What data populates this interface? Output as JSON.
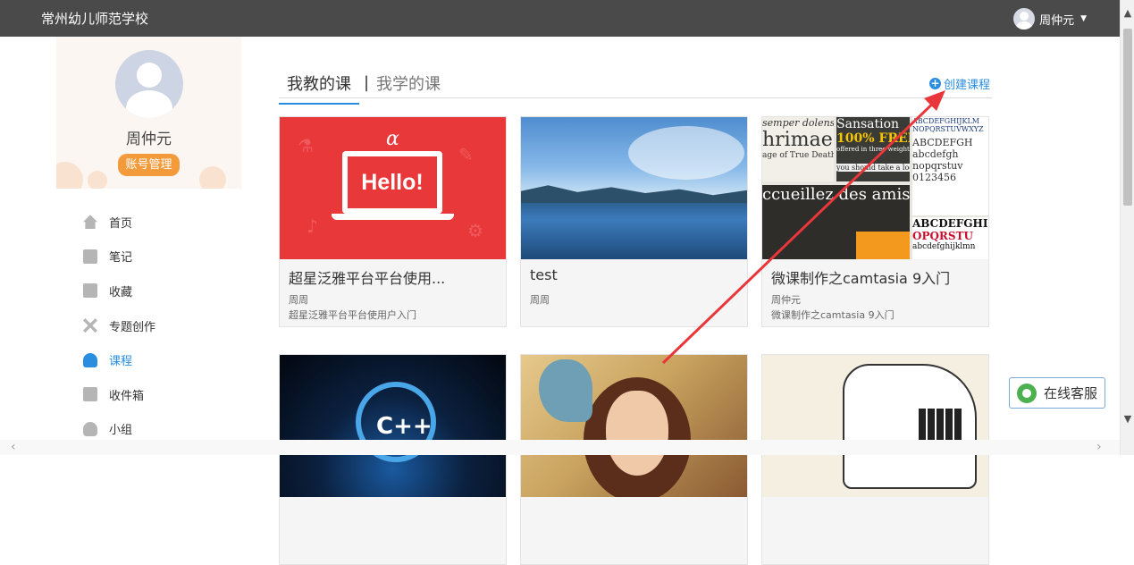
{
  "header": {
    "school_name": "常州幼儿师范学校",
    "user_name": "周仲元",
    "caret_icon": "chevron-down-icon"
  },
  "sidebar": {
    "profile_name": "周仲元",
    "account_button": "账号管理",
    "items": [
      {
        "label": "首页",
        "icon": "home-icon"
      },
      {
        "label": "笔记",
        "icon": "note-icon"
      },
      {
        "label": "收藏",
        "icon": "bookmark-icon"
      },
      {
        "label": "专题创作",
        "icon": "tools-icon"
      },
      {
        "label": "课程",
        "icon": "course-icon",
        "active": true
      },
      {
        "label": "收件箱",
        "icon": "inbox-icon"
      },
      {
        "label": "小组",
        "icon": "group-icon"
      }
    ]
  },
  "main": {
    "tabs": [
      {
        "label": "我教的课",
        "active": true
      },
      {
        "label": "我学的课",
        "active": false
      }
    ],
    "tab_separator": "|",
    "create_course": "创建课程",
    "courses": [
      {
        "title": "超星泛雅平台平台使用...",
        "author": "周周",
        "desc": "超星泛雅平台平台使用户入门",
        "thumb_text": "Hello!"
      },
      {
        "title": "test",
        "author": "周周",
        "desc": ""
      },
      {
        "title": "微课制作之camtasia 9入门",
        "author": "周仲元",
        "desc": "微课制作之camtasia 9入门"
      },
      {
        "title": "",
        "author": "",
        "desc": "",
        "thumb_text": "C++"
      },
      {
        "title": "",
        "author": "",
        "desc": ""
      },
      {
        "title": "",
        "author": "",
        "desc": ""
      }
    ]
  },
  "font_thumb": {
    "lines": [
      "semper dolens",
      "hrimae",
      "age of True Death",
      "Sansation",
      "100% FREE",
      "offered in three weights",
      "you should take a look",
      "ccueillez des amis",
      "ABCDEFGHIJKLM",
      "NOPQRSTUVWXYZ",
      "ABCDEFGH",
      "abcdefgh",
      "nopqrstuv",
      "0123456",
      "ABCDEFGHI",
      "OPQRSTU",
      "abcdefghijklmn"
    ]
  },
  "chat": {
    "label": "在线客服"
  },
  "colors": {
    "accent": "#2a8de0",
    "topbar": "#4a4a4a",
    "orange": "#f39a3a",
    "annotation_arrow": "#e8363a"
  }
}
